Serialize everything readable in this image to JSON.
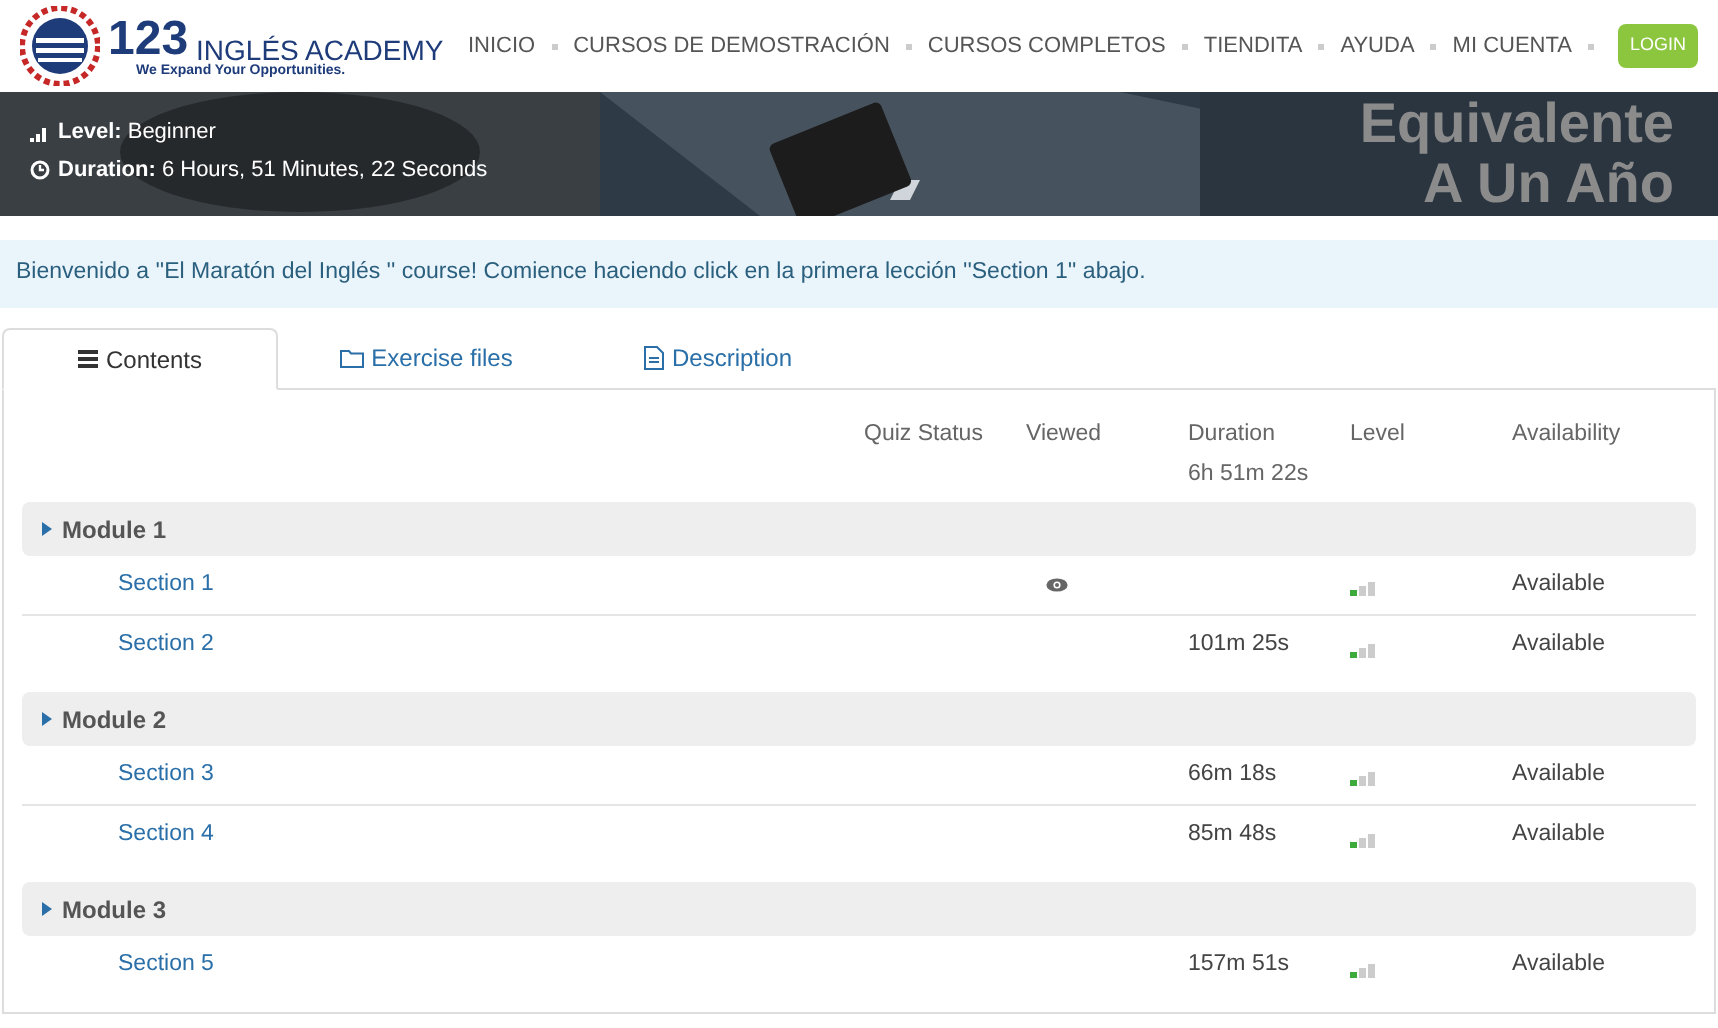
{
  "logo": {
    "number": "123",
    "name": "INGLÉS ACADEMY",
    "tagline": "We Expand Your Opportunities."
  },
  "nav": [
    "INICIO",
    "CURSOS DE DEMOSTRACIÓN",
    "CURSOS COMPLETOS",
    "TIENDITA",
    "AYUDA",
    "MI CUENTA"
  ],
  "login_button": "LOGIN",
  "banner": {
    "level_label": "Level:",
    "level_value": "Beginner",
    "duration_label": "Duration:",
    "duration_value": "6 Hours, 51 Minutes, 22 Seconds",
    "headline_1": "Equivalente",
    "headline_2": "A Un Año"
  },
  "notice": "Bienvenido a ''El Maratón del Inglés '' course! Comience haciendo click en la primera lección ''Section 1'' abajo.",
  "tabs": [
    {
      "label": "Contents",
      "kind": "list",
      "selected": true
    },
    {
      "label": "Exercise files",
      "kind": "folder",
      "selected": false
    },
    {
      "label": "Description",
      "kind": "document",
      "selected": false
    }
  ],
  "columns": {
    "quiz_status": "Quiz Status",
    "viewed": "Viewed",
    "duration": "Duration",
    "duration_total": "6h 51m 22s",
    "level": "Level",
    "availability": "Availability"
  },
  "modules": [
    {
      "title": "Module 1",
      "sections": [
        {
          "title": "Section 1",
          "viewed": true,
          "level": 0.34,
          "availability": "Available"
        },
        {
          "title": "Section 2",
          "viewed": false,
          "duration": "101m 25s",
          "level": 0.34,
          "availability": "Available"
        }
      ]
    },
    {
      "title": "Module 2",
      "sections": [
        {
          "title": "Section 3",
          "viewed": false,
          "duration": "66m 18s",
          "level": 0.34,
          "availability": "Available"
        },
        {
          "title": "Section 4",
          "viewed": false,
          "duration": "85m 48s",
          "level": 0.34,
          "availability": "Available"
        }
      ]
    },
    {
      "title": "Module 3",
      "sections": [
        {
          "title": "Section 5",
          "viewed": false,
          "duration": "157m 51s",
          "level": 0.34,
          "availability": "Available"
        }
      ]
    }
  ]
}
